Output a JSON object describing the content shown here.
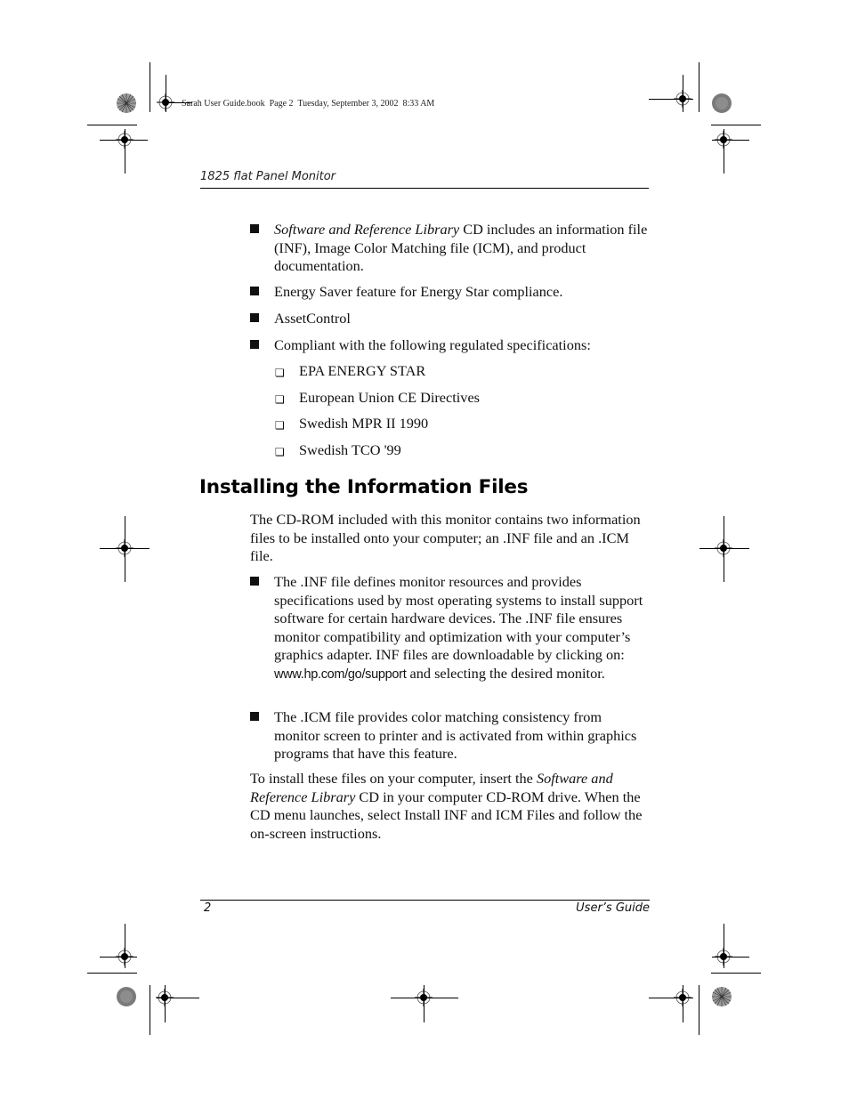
{
  "slug": "Sarah User Guide.book  Page 2  Tuesday, September 3, 2002  8:33 AM",
  "running_head": "1825 flat Panel Monitor",
  "features": [
    {
      "italic": "Software and Reference Library",
      "text": " CD includes an information file (INF), Image Color Matching file (ICM), and product documentation."
    },
    {
      "text": "Energy Saver feature for Energy Star compliance."
    },
    {
      "text": "AssetControl"
    },
    {
      "text": "Compliant with the following regulated specifications:"
    }
  ],
  "specifications": [
    "EPA ENERGY STAR",
    "European Union CE Directives",
    "Swedish MPR II 1990",
    "Swedish TCO '99"
  ],
  "section": {
    "title": "Installing the Information Files",
    "intro": "The CD-ROM included with this monitor contains two information files to be installed onto your computer; an .INF file and an .ICM file.",
    "bullets": [
      {
        "text_before": "The .INF file defines monitor resources and provides specifications used by most operating systems to install support software for certain hardware devices. The .INF file ensures monitor compatibility and optimization with your computer’s graphics adapter. INF files are downloadable by clicking on: ",
        "url": "www.hp.com/go/support",
        "text_after": " and selecting the desired monitor."
      },
      {
        "text": "The .ICM file provides color matching consistency from monitor screen to printer and is activated from within graphics programs that have this feature."
      }
    ],
    "closing": {
      "before": "To install these files on your computer, insert the ",
      "italic": "Software and Reference Library",
      "after": " CD in your computer CD-ROM drive. When the CD menu launches, select Install INF and ICM Files and follow the on-screen instructions."
    }
  },
  "footer": {
    "page_number": "2",
    "guide_title": "User’s Guide"
  },
  "icons": {
    "square_bullet": "■",
    "box_bullet": "❏"
  }
}
